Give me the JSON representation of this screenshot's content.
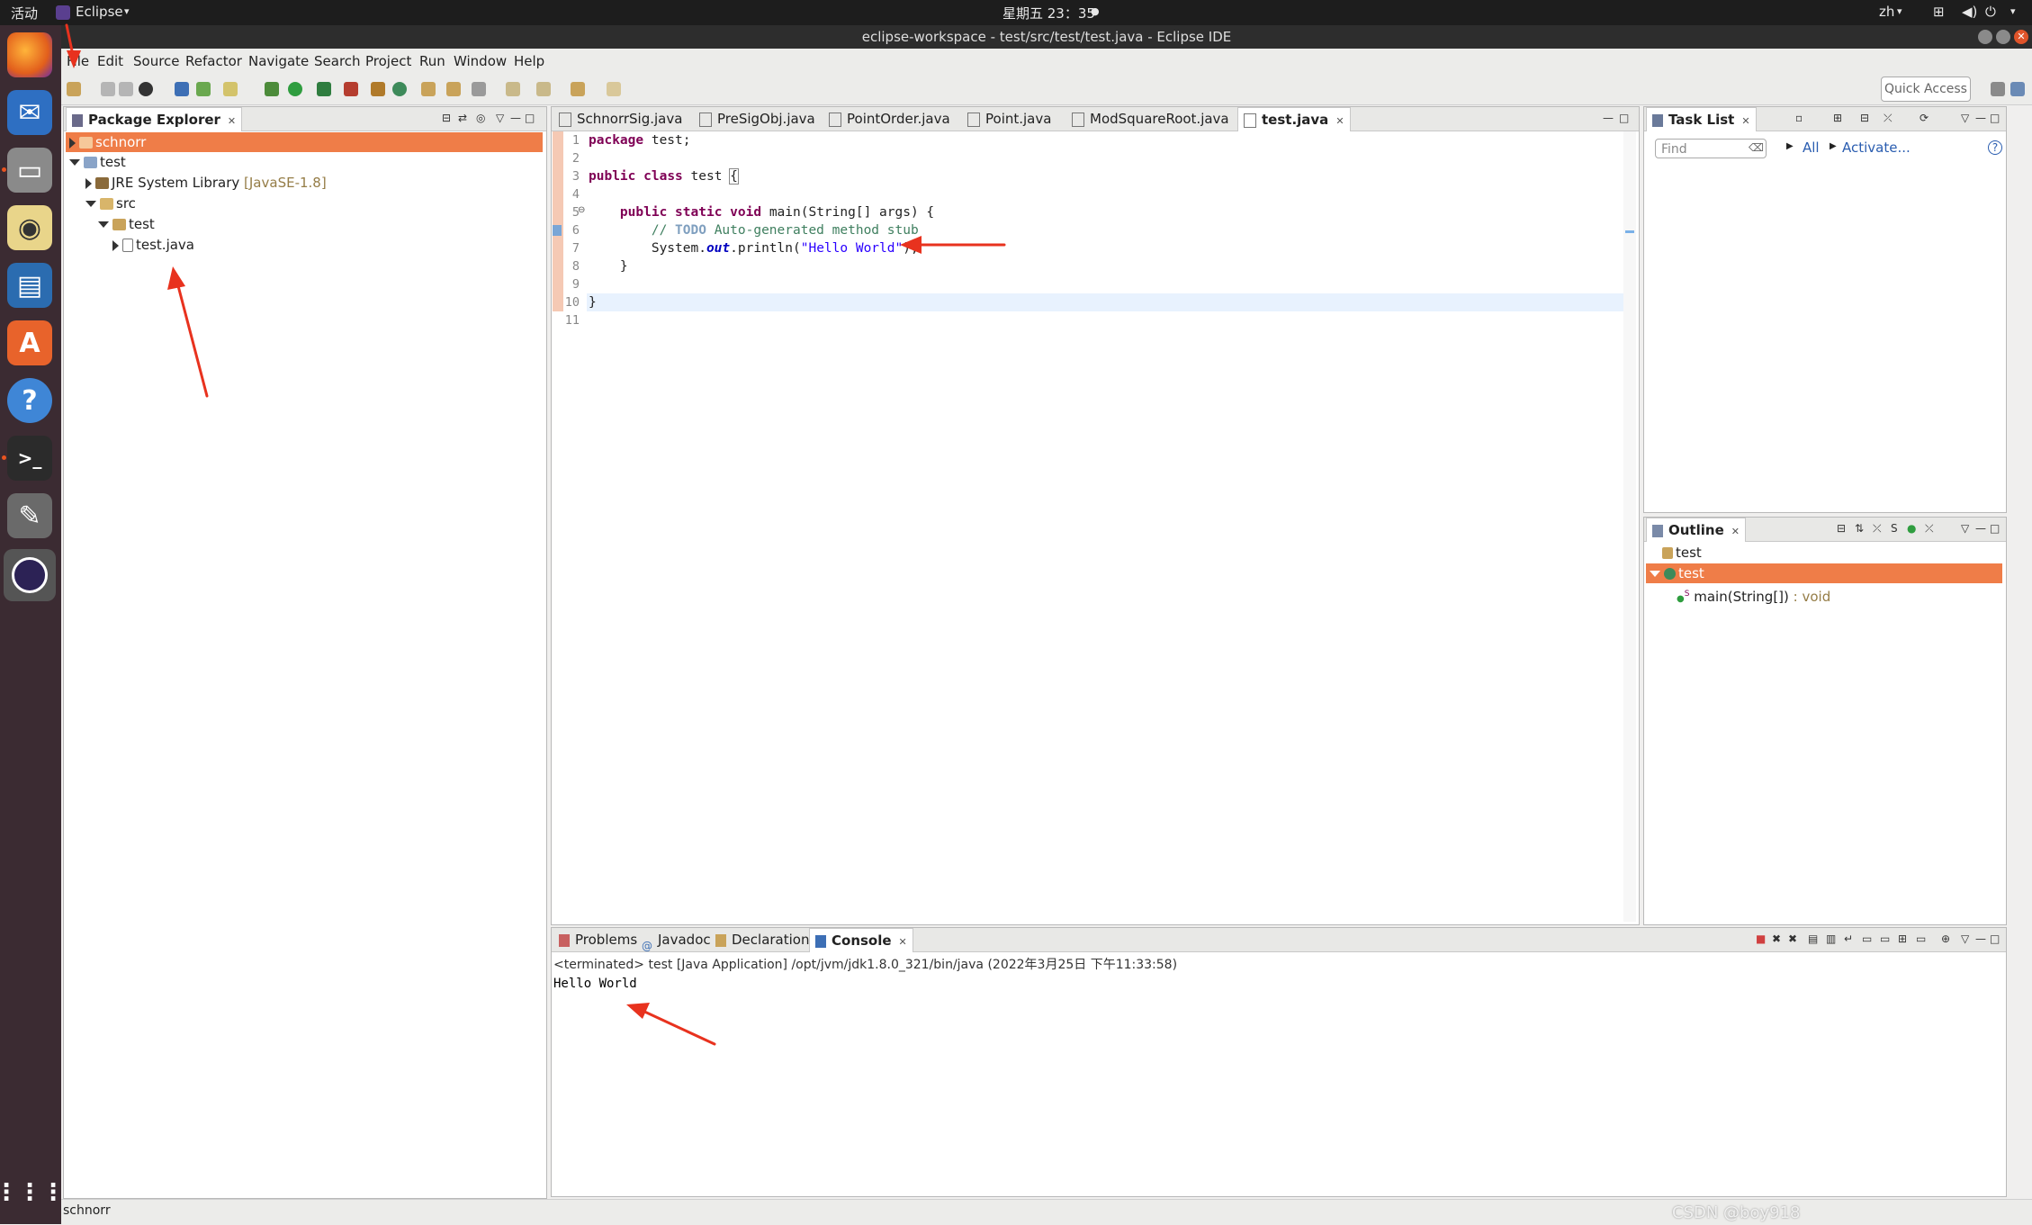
{
  "topbar": {
    "activities": "活动",
    "app_name": "Eclipse",
    "clock": "星期五 23：35",
    "input_method": "zh"
  },
  "window": {
    "title": "eclipse-workspace - test/src/test/test.java - Eclipse IDE"
  },
  "menubar": [
    "File",
    "Edit",
    "Source",
    "Refactor",
    "Navigate",
    "Search",
    "Project",
    "Run",
    "Window",
    "Help"
  ],
  "toolbar": {
    "quick_access": "Quick Access"
  },
  "package_explorer": {
    "title": "Package Explorer",
    "items": [
      {
        "label": "schnorr",
        "suffix": ""
      },
      {
        "label": "test",
        "suffix": ""
      },
      {
        "label": "JRE System Library",
        "suffix": "[JavaSE-1.8]"
      },
      {
        "label": "src",
        "suffix": ""
      },
      {
        "label": "test",
        "suffix": ""
      },
      {
        "label": "test.java",
        "suffix": ""
      }
    ]
  },
  "editor": {
    "tabs": [
      "SchnorrSig.java",
      "PreSigObj.java",
      "PointOrder.java",
      "Point.java",
      "ModSquareRoot.java",
      "test.java"
    ],
    "active_tab": "test.java",
    "line_numbers": [
      "1",
      "2",
      "3",
      "4",
      "5",
      "6",
      "7",
      "8",
      "9",
      "10",
      "11"
    ],
    "code": {
      "l1_kw": "package",
      "l1_rest": " test;",
      "l3_kw1": "public",
      "l3_kw2": "class",
      "l3_rest": " test ",
      "l3_brace": "{",
      "l5_kw1": "public",
      "l5_kw2": "static",
      "l5_kw3": "void",
      "l5_rest": " main(String[] args) {",
      "l6_cm1": "// ",
      "l6_todo": "TODO",
      "l6_cm2": " Auto-generated method stub",
      "l7_a": "System.",
      "l7_fld": "out",
      "l7_b": ".println(",
      "l7_str": "\"Hello World\"",
      "l7_c": ");",
      "l8": "}",
      "l10": "}"
    }
  },
  "task_list": {
    "title": "Task List",
    "find_placeholder": "Find",
    "all_label": "All",
    "activate_label": "Activate..."
  },
  "outline": {
    "title": "Outline",
    "items": [
      {
        "label": "test"
      },
      {
        "label": "test"
      },
      {
        "label": "main(String[])",
        "suffix": " : void"
      }
    ]
  },
  "console": {
    "tabs": [
      "Problems",
      "Javadoc",
      "Declaration",
      "Console"
    ],
    "active_tab": "Console",
    "header": "<terminated> test [Java Application] /opt/jvm/jdk1.8.0_321/bin/java (2022年3月25日 下午11:33:58)",
    "output": "Hello World"
  },
  "statusbar": {
    "text": "schnorr"
  },
  "watermark": "CSDN @boy918",
  "colors": {
    "selection": "#ef7d48",
    "keyword": "#7f0055",
    "string": "#2a00ff",
    "comment": "#3f7f5f",
    "annotation_arrow": "#e8321e"
  }
}
